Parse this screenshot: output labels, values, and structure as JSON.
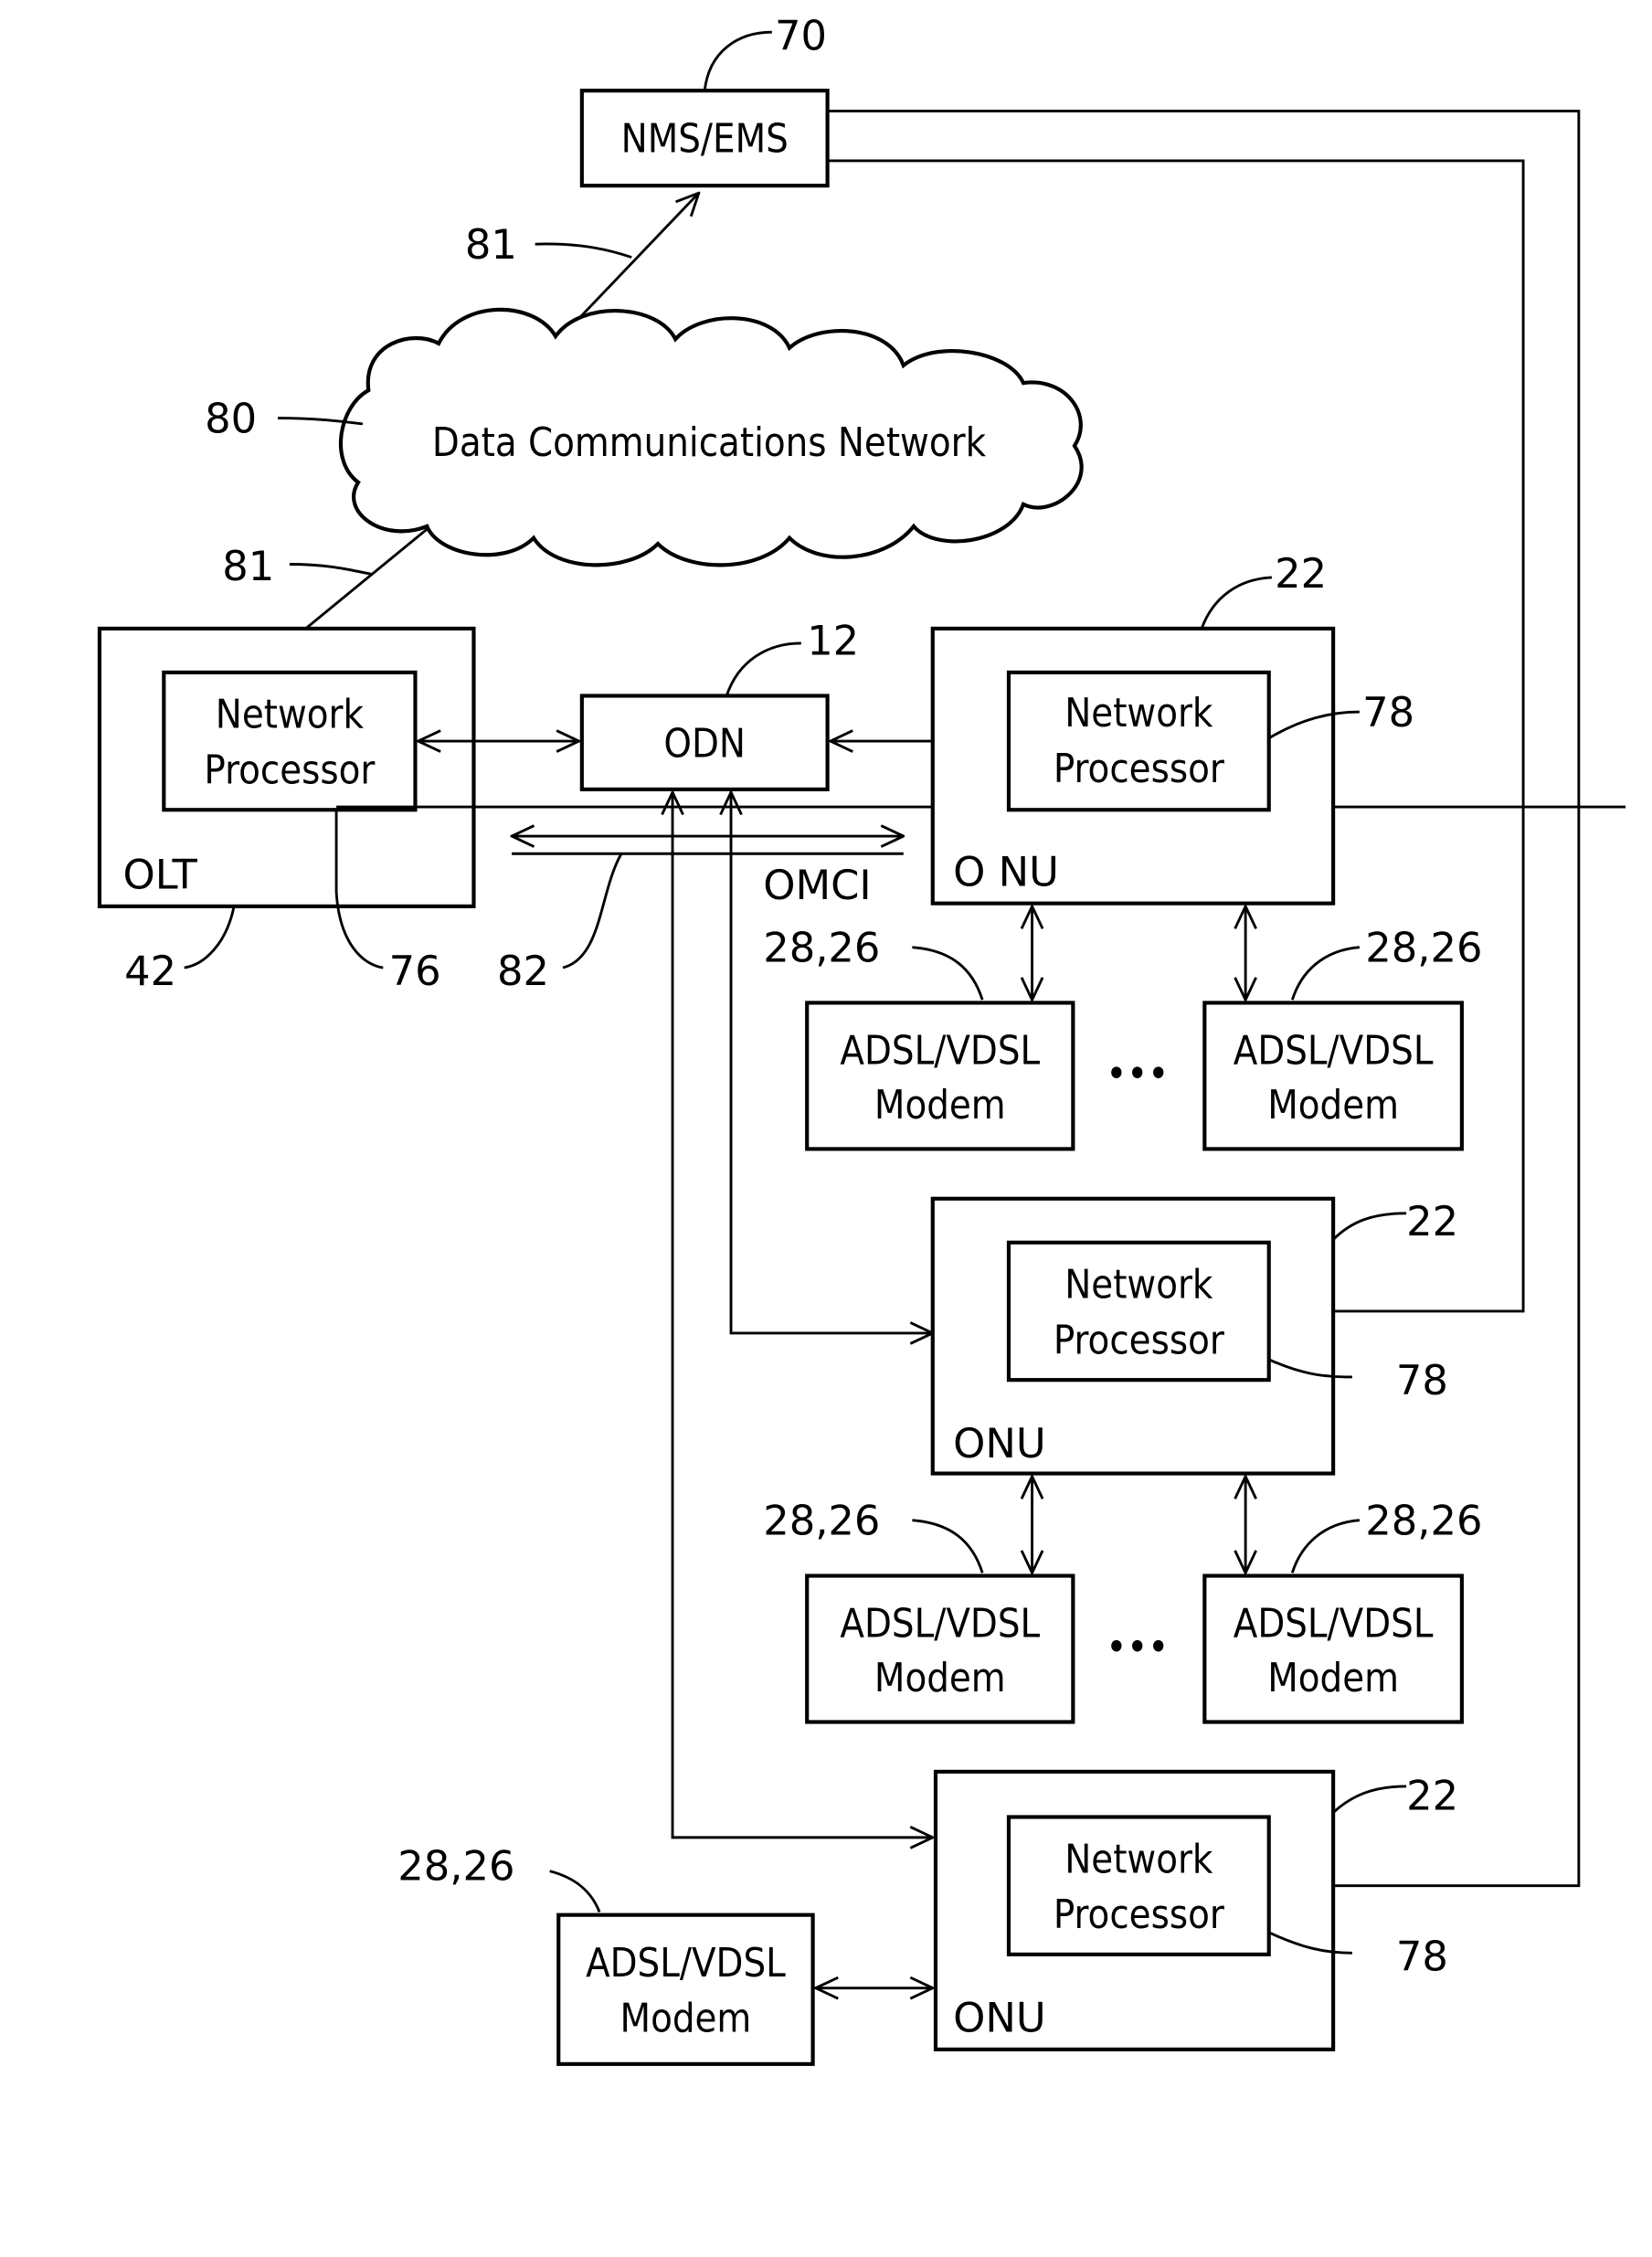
{
  "nodes": {
    "nms": {
      "label": "NMS/EMS",
      "ref": "70"
    },
    "dcn": {
      "label": "Data Communications Network",
      "ref": "80"
    },
    "olt": {
      "label": "OLT",
      "ref": "42",
      "np_line1": "Network",
      "np_line2": "Processor",
      "np_ref": "76"
    },
    "odn": {
      "label": "ODN",
      "ref": "12"
    },
    "onu1": {
      "label": "O NU",
      "ref": "22",
      "np_line1": "Network",
      "np_line2": "Processor",
      "np_ref": "78"
    },
    "onu2": {
      "label": "ONU",
      "ref": "22",
      "np_line1": "Network",
      "np_line2": "Processor",
      "np_ref": "78"
    },
    "onu3": {
      "label": "ONU",
      "ref": "22",
      "np_line1": "Network",
      "np_line2": "Processor",
      "np_ref": "78"
    }
  },
  "modem": {
    "line1": "ADSL/VDSL",
    "line2": "Modem",
    "ref": "28,26"
  },
  "links": {
    "ref81": "81",
    "omci": "OMCI",
    "ref82": "82"
  },
  "ellipsis": "•••"
}
